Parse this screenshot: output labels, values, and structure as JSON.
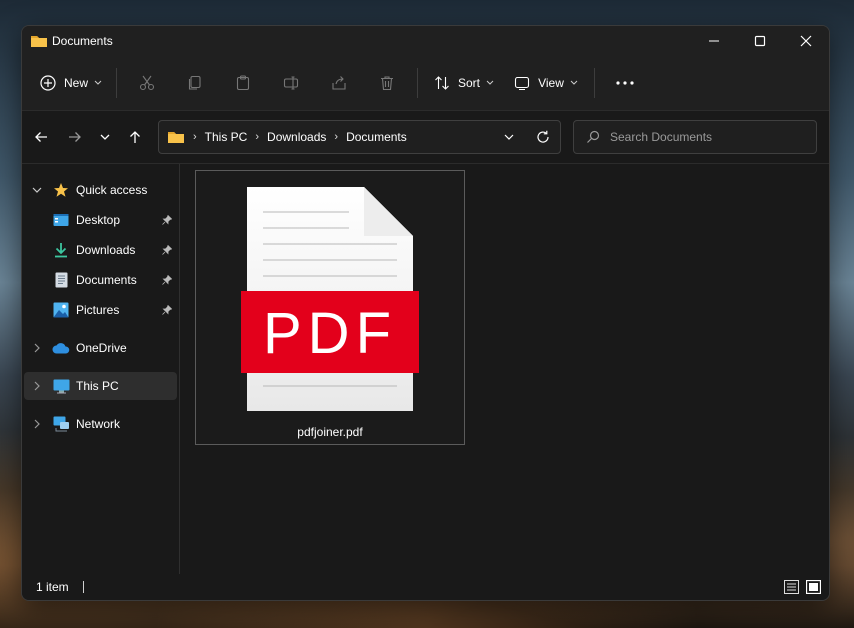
{
  "window": {
    "title": "Documents",
    "controls": {
      "minimize": "minimize",
      "maximize": "maximize",
      "close": "close"
    }
  },
  "toolbar": {
    "new_label": "New",
    "sort_label": "Sort",
    "view_label": "View",
    "icons": [
      "cut-icon",
      "copy-icon",
      "paste-icon",
      "rename-icon",
      "share-icon",
      "delete-icon",
      "more-icon"
    ]
  },
  "navigation": {
    "breadcrumb": [
      "This PC",
      "Downloads",
      "Documents"
    ]
  },
  "search": {
    "placeholder": "Search Documents"
  },
  "sidebar": {
    "items": [
      {
        "label": "Quick access",
        "icon": "star-icon",
        "expanded": true
      },
      {
        "label": "Desktop",
        "icon": "desktop-icon",
        "pinned": true
      },
      {
        "label": "Downloads",
        "icon": "downloads-icon",
        "pinned": true
      },
      {
        "label": "Documents",
        "icon": "documents-icon",
        "pinned": true
      },
      {
        "label": "Pictures",
        "icon": "pictures-icon",
        "pinned": true
      },
      {
        "label": "OneDrive",
        "icon": "cloud-icon"
      },
      {
        "label": "This PC",
        "icon": "computer-icon",
        "selected": true
      },
      {
        "label": "Network",
        "icon": "network-icon"
      }
    ]
  },
  "files": [
    {
      "name": "pdfjoiner.pdf",
      "icon": "pdf-file-icon",
      "icon_text": "PDF"
    }
  ],
  "status": {
    "item_count": "1 item"
  },
  "colors": {
    "window_bg": "#202020",
    "content_bg": "#191919",
    "folder_yellow": "#F8C24A",
    "pdf_red": "#E3001B",
    "selected_bg": "#2E2E2E"
  }
}
